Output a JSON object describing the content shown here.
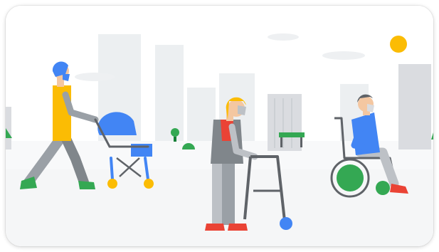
{
  "illustration": {
    "scene": "accessibility-street",
    "icons": [
      "stroller-icon",
      "walker-icon",
      "wheelchair-icon",
      "sun-icon",
      "building-icon",
      "bench-icon",
      "tree-icon"
    ],
    "colors": {
      "blue": "#4285f4",
      "green": "#34a853",
      "yellow": "#fbbc04",
      "red": "#ea4335",
      "gray": "#9aa0a6",
      "dark": "#5f6368",
      "skin": "#f4c7a1",
      "sky": "#ffffff",
      "ground": "#f1f3f4"
    }
  }
}
